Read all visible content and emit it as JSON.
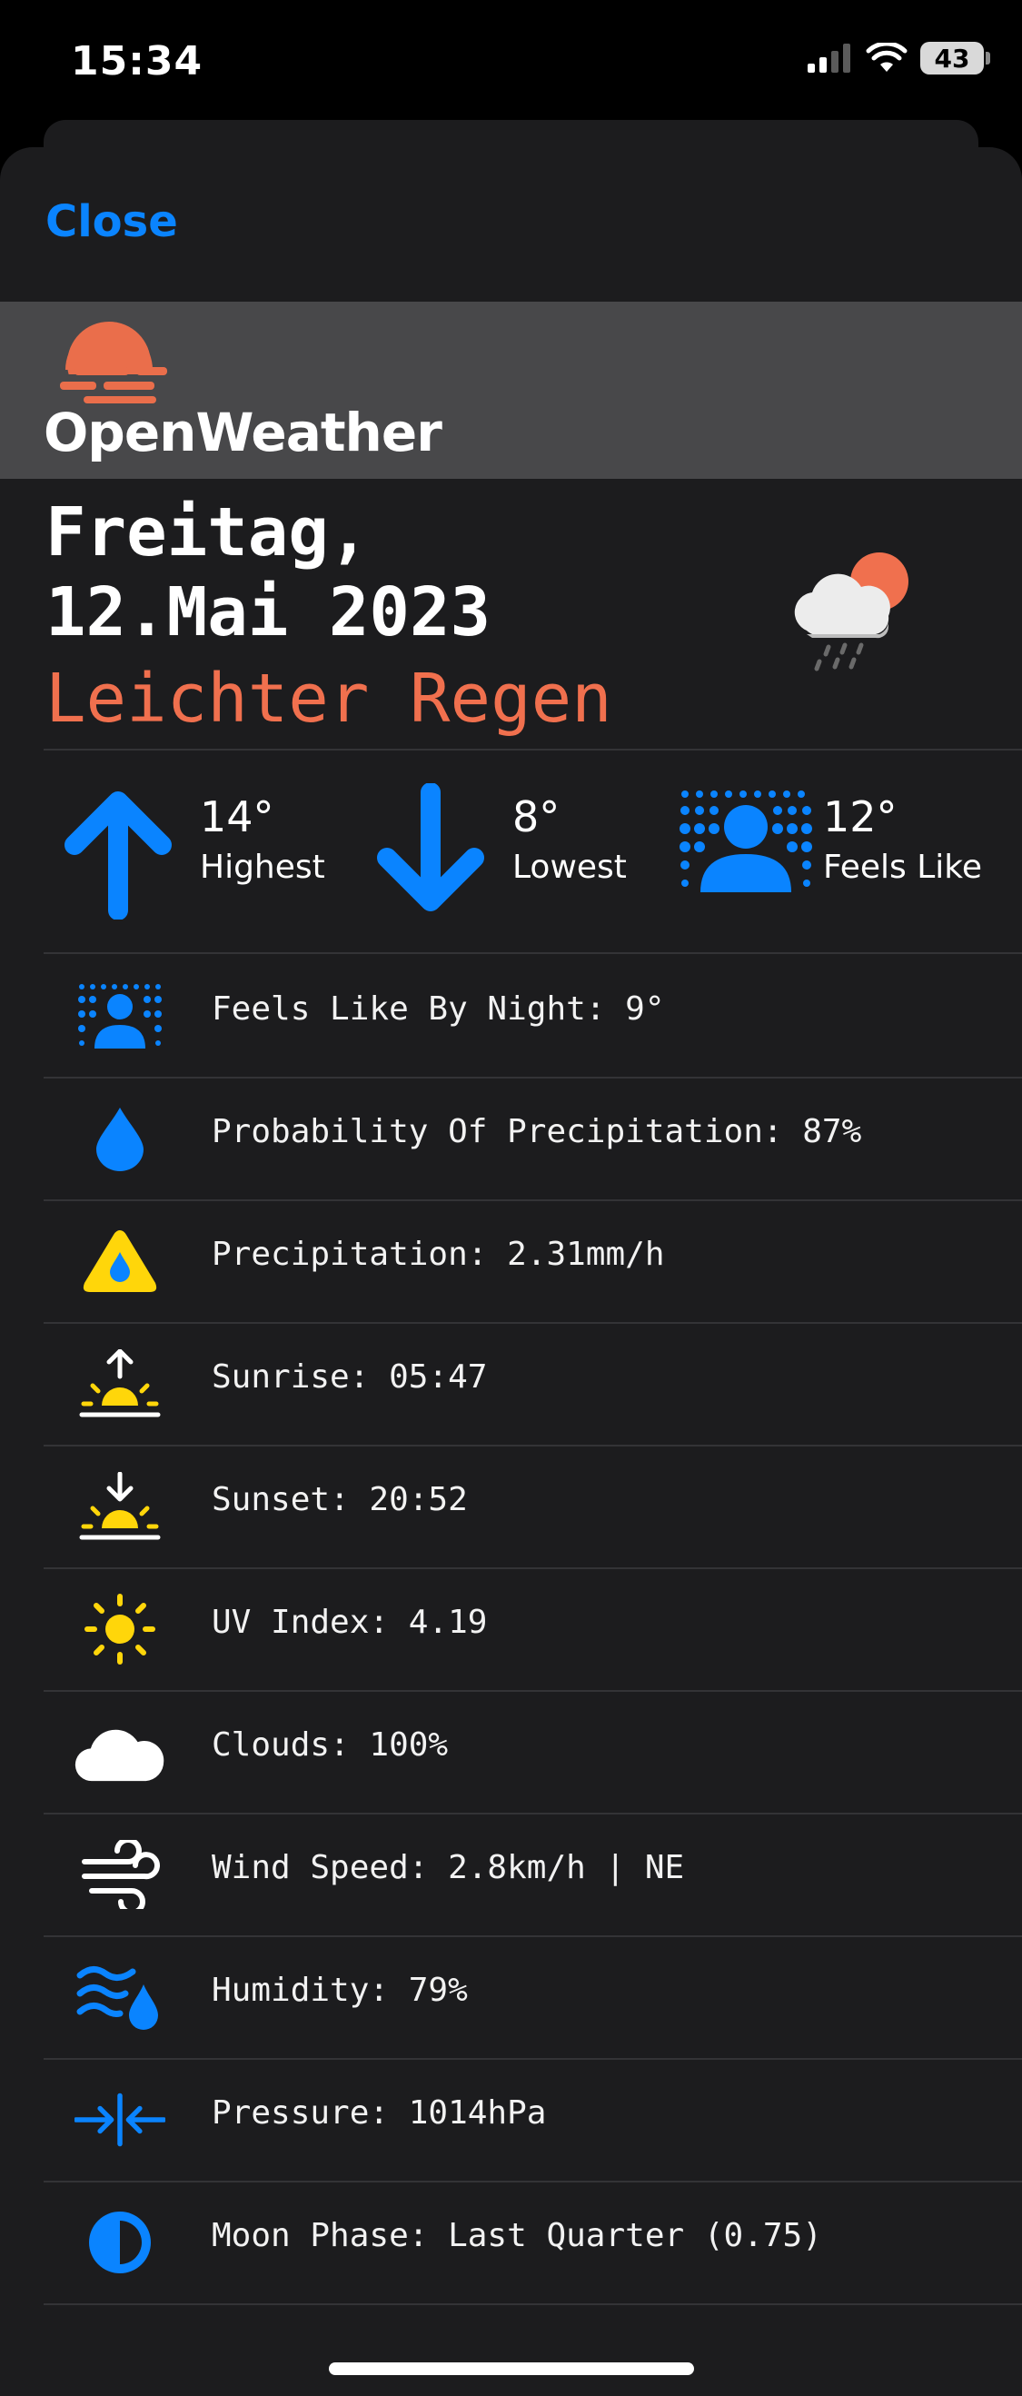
{
  "status_bar": {
    "time": "15:34",
    "battery": "43"
  },
  "sheet": {
    "close_label": "Close"
  },
  "brand": {
    "name": "OpenWeather"
  },
  "forecast": {
    "day_line": "Freitag,",
    "date_line": "12.Mai 2023",
    "condition": "Leichter Regen",
    "icon": "cloud-rain-sun-icon"
  },
  "stats": [
    {
      "value": "14°",
      "label": "Highest",
      "icon": "arrow-up-icon"
    },
    {
      "value": "8°",
      "label": "Lowest",
      "icon": "arrow-down-icon"
    },
    {
      "value": "12°",
      "label": "Feels Like",
      "icon": "person-dots-icon"
    }
  ],
  "details": [
    {
      "text": "Feels Like By Night: 9°",
      "icon": "person-dots-icon"
    },
    {
      "text": "Probability Of Precipitation: 87%",
      "icon": "drop-icon"
    },
    {
      "text": "Precipitation: 2.31mm/h",
      "icon": "warning-drop-icon"
    },
    {
      "text": "Sunrise: 05:47",
      "icon": "sunrise-icon"
    },
    {
      "text": "Sunset: 20:52",
      "icon": "sunset-icon"
    },
    {
      "text": "UV Index: 4.19",
      "icon": "sun-icon"
    },
    {
      "text": "Clouds: 100%",
      "icon": "cloud-icon"
    },
    {
      "text": "Wind Speed: 2.8km/h | NE",
      "icon": "wind-icon"
    },
    {
      "text": "Humidity: 79%",
      "icon": "humidity-icon"
    },
    {
      "text": "Pressure: 1014hPa",
      "icon": "pressure-icon"
    },
    {
      "text": "Moon Phase: Last Quarter (0.75)",
      "icon": "moon-phase-icon"
    }
  ],
  "colors": {
    "accent_blue": "#0a84ff",
    "condition_orange": "#f0704e",
    "sun_yellow": "#ffd60a",
    "logo_orange": "#ea6e4b"
  }
}
